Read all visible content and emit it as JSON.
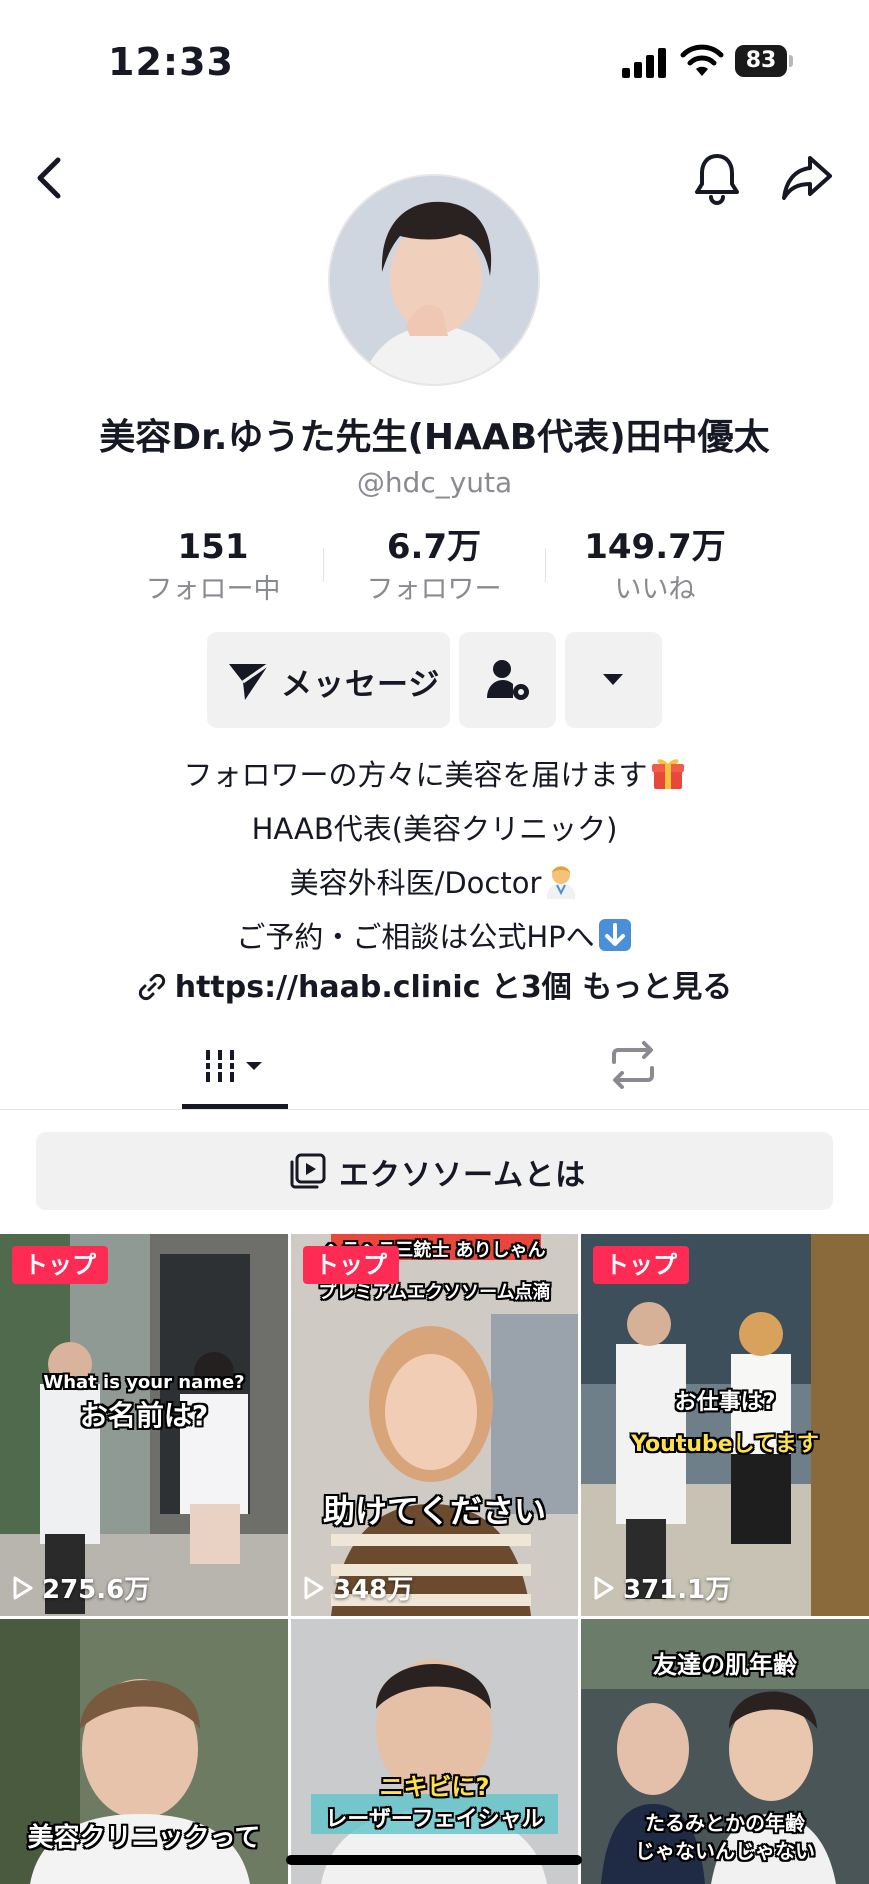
{
  "status_bar": {
    "time": "12:33",
    "battery": "83"
  },
  "profile": {
    "display_name": "美容Dr.ゆうた先生(HAAB代表)田中優太",
    "handle": "@hdc_yuta"
  },
  "stats": [
    {
      "value": "151",
      "label": "フォロー中"
    },
    {
      "value": "6.7万",
      "label": "フォロワー"
    },
    {
      "value": "149.7万",
      "label": "いいね"
    }
  ],
  "actions": {
    "message_label": "メッセージ"
  },
  "bio": {
    "lines": [
      "フォロワーの方々に美容を届けます",
      "HAAB代表(美容クリニック)",
      "美容外科医/Doctor",
      "ご予約・ご相談は公式HPへ"
    ],
    "link_text": "https://haab.clinic と3個 もっと見る"
  },
  "playlist": {
    "label": "エクソソームとは"
  },
  "videos": [
    {
      "badge": "トップ",
      "views": "275.6万",
      "caption_top": "What is your name?",
      "caption_main": "お名前は?",
      "caption_extra": ""
    },
    {
      "badge": "トップ",
      "views": "348万",
      "caption_top": "ヘラヘラ三銃士 ありしゃん",
      "caption_main": "助けてください",
      "caption_extra": "プレミアムエクソソーム点滴"
    },
    {
      "badge": "トップ",
      "views": "371.1万",
      "caption_top": "お仕事は?",
      "caption_main": "Youtubeしてます",
      "caption_extra": ""
    },
    {
      "badge": "",
      "views": "",
      "caption_top": "",
      "caption_main": "美容クリニックって",
      "caption_extra": ""
    },
    {
      "badge": "",
      "views": "",
      "caption_top": "ニキビに?",
      "caption_main": "レーザーフェイシャル",
      "caption_extra": ""
    },
    {
      "badge": "",
      "views": "",
      "caption_top": "友達の肌年齢",
      "caption_main": "たるみとかの年齢",
      "caption_extra": "じゃないんじゃない"
    }
  ],
  "icons": {
    "back": "chevron-left-icon",
    "bell": "bell-icon",
    "share": "share-arrow-icon",
    "message": "paper-plane-icon",
    "add_friend": "person-gear-icon",
    "more": "caret-down-icon",
    "link": "link-icon",
    "videos_tab": "grid-bars-icon",
    "repost_tab": "repost-icon",
    "playlist": "playlist-icon"
  },
  "colors": {
    "accent": "#fe2c55",
    "text": "#161823",
    "muted": "#8a8b91",
    "button_bg": "#f1f1f2"
  }
}
